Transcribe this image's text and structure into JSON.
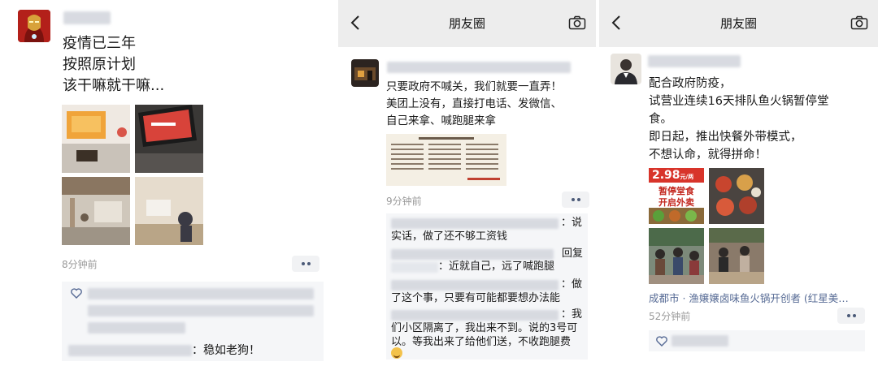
{
  "panel1": {
    "post_lines": [
      "疫情已三年",
      "按照原计划",
      "该干嘛就干嘛..."
    ],
    "time": "8分钟前",
    "comment_text": "：稳如老狗！"
  },
  "panel2": {
    "nav_title": "朋友圈",
    "post_lines": [
      "只要政府不喊关，我们就要一直弄！",
      "美团上没有，直接打电话、发微信、",
      "自己来拿、喊跑腿来拿"
    ],
    "time": "9分钟前",
    "comments": [
      {
        "lines": [
          "：说",
          "实话，做了还不够工资钱"
        ]
      },
      {
        "lines": [
          "回复",
          "：近就自己，远了喊跑腿"
        ]
      },
      {
        "lines": [
          "：做",
          "了这个事，只要有可能都要想办法能"
        ]
      },
      {
        "lines": [
          "：我",
          "们小区隔离了，我出来不到。说的3号可",
          "以。等我出来了给他们送，不收跑腿费"
        ]
      }
    ]
  },
  "panel3": {
    "nav_title": "朋友圈",
    "post_lines": [
      "配合政府防疫，",
      "试营业连续16天排队鱼火锅暂停堂",
      "食。",
      "即日起，推出快餐外带模式，",
      "不想认命，就得拼命！"
    ],
    "photo_text": {
      "price": "2.98",
      "unit": "元/两",
      "line1": "暂停堂食",
      "line2": "开启外卖"
    },
    "location": "成都市 · 渔嬢嬢卤味鱼火锅开创者 (红星美…",
    "time": "52分钟前"
  },
  "icons": [
    "back-arrow-icon",
    "camera-icon",
    "heart-icon",
    "more-dots-icon"
  ]
}
